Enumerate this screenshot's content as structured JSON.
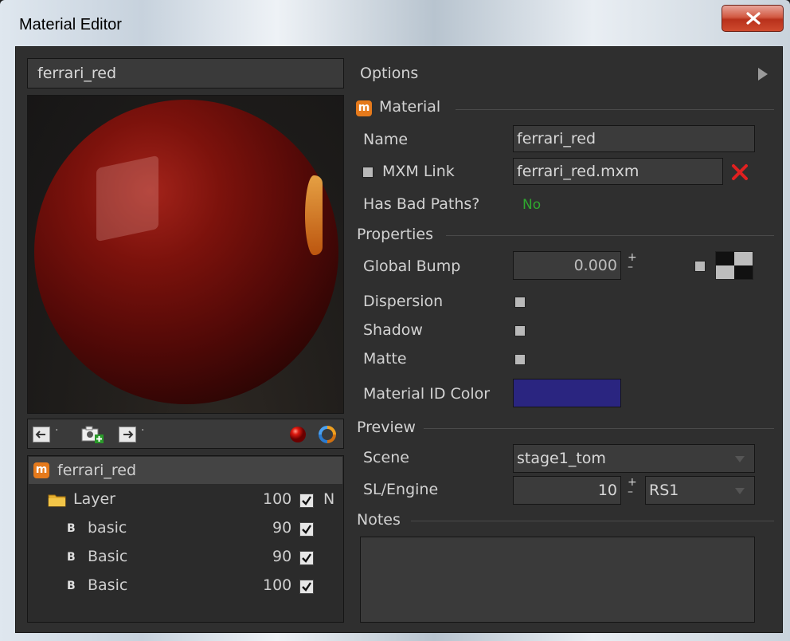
{
  "window": {
    "title": "Material Editor"
  },
  "left": {
    "material_name_field": "ferrari_red",
    "tree": {
      "root": {
        "label": "ferrari_red"
      },
      "layer": {
        "label": "Layer",
        "value": "100",
        "extra": "N"
      },
      "items": [
        {
          "label": "basic",
          "value": "90"
        },
        {
          "label": "Basic",
          "value": "90"
        },
        {
          "label": "Basic",
          "value": "100"
        }
      ]
    }
  },
  "right": {
    "options_label": "Options",
    "material_section": "Material",
    "name_label": "Name",
    "name_value": "ferrari_red",
    "mxm_link_label": "MXM Link",
    "mxm_value": "ferrari_red.mxm",
    "bad_paths_label": "Has Bad Paths?",
    "bad_paths_value": "No",
    "properties_section": "Properties",
    "global_bump_label": "Global Bump",
    "global_bump_value": "0.000",
    "dispersion_label": "Dispersion",
    "shadow_label": "Shadow",
    "matte_label": "Matte",
    "material_id_label": "Material ID Color",
    "preview_section": "Preview",
    "scene_label": "Scene",
    "scene_value": "stage1_tom",
    "sl_engine_label": "SL/Engine",
    "sl_value": "10",
    "engine_value": "RS1",
    "notes_section": "Notes"
  },
  "colors": {
    "material_id": "#2a2580",
    "bad_paths_ok": "#2fa82f",
    "remove_x": "#e02020",
    "material_icon": "#e57a1c"
  }
}
